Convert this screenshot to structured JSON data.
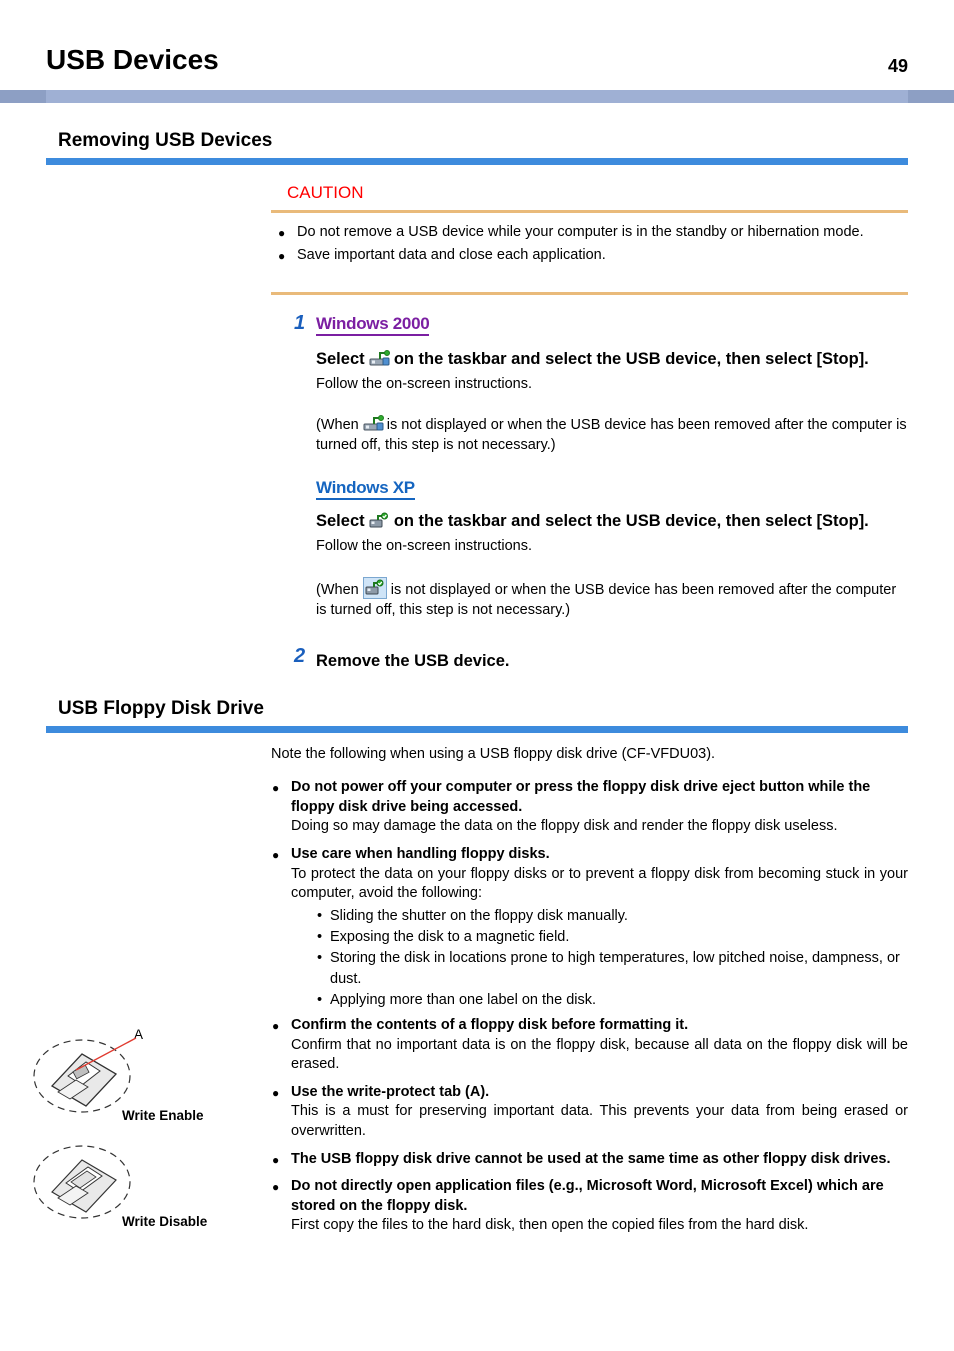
{
  "header": {
    "title": "USB Devices",
    "page_number": "49"
  },
  "sections": [
    {
      "title": "Removing USB Devices"
    },
    {
      "title": "USB Floppy Disk Drive"
    }
  ],
  "caution": {
    "label": "CAUTION",
    "items": [
      "Do not remove a USB device while your computer is in the standby or hibernation mode.",
      "Save important data and close each application."
    ]
  },
  "steps": {
    "step1": {
      "number": "1",
      "win2000": {
        "tag": "Windows 2000",
        "bold_before": "Select",
        "icon": "safely-remove-hardware-icon-2000",
        "bold_after": "on the taskbar and select the USB device, then select [Stop].",
        "follow": "Follow the on-screen instructions.",
        "note_before": "(When",
        "note_after": "is not displayed or when the USB device has been removed after the computer is turned off, this step is not necessary.)"
      },
      "winxp": {
        "tag": "Windows XP",
        "bold_before": "Select",
        "icon": "safely-remove-hardware-icon-xp",
        "bold_after": "on the taskbar and select the USB device, then select [Stop].",
        "follow": "Follow the on-screen instructions.",
        "note_before": "(When",
        "note_after": "is not displayed or when the USB device has been removed after the computer is turned off, this step is not necessary.)"
      }
    },
    "step2": {
      "number": "2",
      "text": "Remove the USB device."
    }
  },
  "floppy": {
    "intro": "Note the following when using a USB floppy disk drive (CF-VFDU03).",
    "items": [
      {
        "bold": "Do not power off your computer or press the floppy disk drive eject button while the floppy disk drive being accessed.",
        "body": "Doing so may damage the data on the floppy disk and render the floppy disk useless."
      },
      {
        "bold": "Use care when handling floppy disks.",
        "body": "To protect the data on your floppy disks or to prevent a floppy disk from becoming stuck in your computer, avoid the following:",
        "sub": [
          "Sliding the shutter on the floppy disk manually.",
          "Exposing the disk to a magnetic field.",
          "Storing the disk in locations prone to high temperatures, low pitched noise, dampness, or dust.",
          "Applying more than one label on the disk."
        ]
      },
      {
        "bold": "Confirm the contents of a floppy disk before formatting it.",
        "body": "Confirm that no important data is on the floppy disk, because all data on the floppy disk will be erased."
      },
      {
        "bold": "Use the write-protect tab (A).",
        "body": "This is a must for preserving important data.  This prevents your data from being erased or overwritten."
      },
      {
        "bold": "The USB floppy disk drive cannot be used at the same time as other floppy disk drives.",
        "body": ""
      },
      {
        "bold": "Do not directly open application files (e.g., Microsoft Word, Microsoft Excel) which are stored on the floppy disk.",
        "body": "First copy the files to the hard disk, then open the copied files from the hard disk."
      }
    ],
    "figures": [
      {
        "label_a": "A",
        "caption": "Write Enable"
      },
      {
        "caption": "Write Disable"
      }
    ]
  },
  "colors": {
    "header_band": "#8d9fc4",
    "section_rule": "#3d8bdd",
    "caution_rule": "#e9ba7a",
    "caution_text": "#ff0000",
    "step_number": "#1a5fbd",
    "win2000_tag": "#7b1fa2",
    "winxp_tag": "#1565c0"
  }
}
